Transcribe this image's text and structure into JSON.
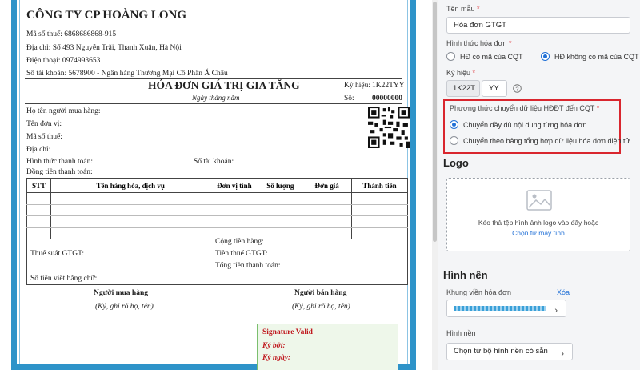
{
  "invoice": {
    "company": "CÔNG TY CP HOÀNG LONG",
    "tax_code": "Mã số thuế:  6868686868-915",
    "address": "Địa chỉ:  Số 493 Nguyễn Trãi, Thanh Xuân, Hà Nội",
    "phone": "Điện thoại:  0974993653",
    "account": "Số tài khoản:  5678900 - Ngân hàng Thương Mại Cổ Phần Á Châu",
    "title": "HÓA ĐƠN GIÁ TRỊ GIA TĂNG",
    "date_line": "Ngày     tháng     năm",
    "symbol_label": "Ký hiệu:",
    "symbol_value": "1K22TYY",
    "number_label": "Số:",
    "number_value": "00000000",
    "buyer_name": "Họ tên người mua hàng:",
    "unit_name": "Tên đơn vị:",
    "buyer_tax": "Mã số thuế:",
    "buyer_address": "Địa chỉ:",
    "payment_method": "Hình thức thanh toán:",
    "buyer_account": "Số tài khoản:",
    "currency": "Đồng tiền thanh toán:",
    "columns": [
      "STT",
      "Tên hàng hóa, dịch vụ",
      "Đơn vị tính",
      "Số lượng",
      "Đơn giá",
      "Thành tiền"
    ],
    "subtotal": "Cộng tiền hàng:",
    "vat_rate": "Thuế suất GTGT:",
    "vat_amount": "Tiền thuế GTGT:",
    "total": "Tổng tiền thanh toán:",
    "in_words": "Số tiền viết bằng chữ:",
    "buyer_sign_title": "Người mua hàng",
    "buyer_sign_note": "(Ký, ghi rõ họ, tên)",
    "seller_sign_title": "Người bán hàng",
    "seller_sign_note": "(Ký, ghi rõ họ, tên)",
    "sig_valid": "Signature Valid",
    "sig_by": "Ký bởi:",
    "sig_date": "Ký ngày:"
  },
  "panel": {
    "template_name_label": "Tên mẫu",
    "template_name_value": "Hóa đơn GTGT",
    "invoice_form_label": "Hình thức hóa đơn",
    "form_option_1": "HĐ có mã của CQT",
    "form_option_2": "HĐ không có mã của CQT",
    "symbol_label": "Ký hiệu",
    "symbol_value": "1K22T",
    "symbol_suffix": "YY",
    "transfer_label": "Phương thức chuyển dữ liệu HĐĐT đến CQT",
    "transfer_option_1": "Chuyển đầy đủ nội dung từng hóa đơn",
    "transfer_option_2": "Chuyển theo bảng tổng hợp dữ liệu hóa đơn điện tử",
    "logo_title": "Logo",
    "logo_drop_text": "Kéo thả tệp hình ảnh logo vào đây hoặc",
    "logo_pick_link": "Chọn từ máy tính",
    "background_title": "Hình nền",
    "border_label": "Khung viền hóa đơn",
    "border_delete": "Xóa",
    "bg_label": "Hình nền",
    "bg_select_value": "Chọn từ bộ hình nền có sẵn",
    "required_mark": "*",
    "help_icon": "question-circle-icon"
  },
  "colors": {
    "border_blue": "#2e93c9",
    "accent": "#1f6fd6",
    "highlight": "#d9262e",
    "signature_bg": "#eef7ea",
    "signature_text": "#c0191f"
  }
}
